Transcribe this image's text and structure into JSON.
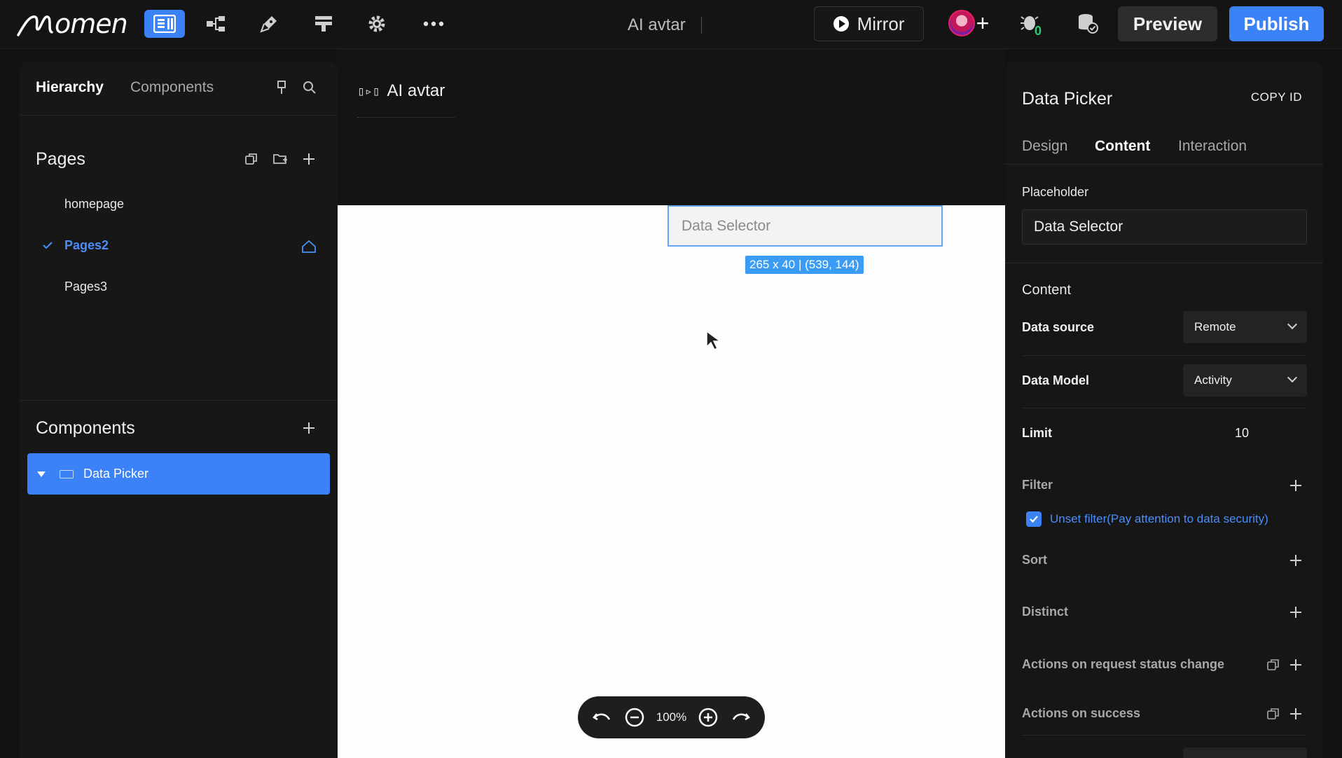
{
  "app": {
    "logo_text": "omen"
  },
  "toolbar": {
    "project_title": "AI avtar",
    "mirror_label": "Mirror",
    "preview_label": "Preview",
    "publish_label": "Publish",
    "badge_count": "0"
  },
  "left_panel": {
    "tabs": [
      {
        "label": "Hierarchy",
        "active": true
      },
      {
        "label": "Components",
        "active": false
      }
    ],
    "pages_title": "Pages",
    "pages": [
      {
        "label": "homepage",
        "active": false
      },
      {
        "label": "Pages2",
        "active": true,
        "home": true
      },
      {
        "label": "Pages3",
        "active": false
      }
    ],
    "components_title": "Components",
    "components": [
      {
        "label": "Data Picker",
        "selected": true
      }
    ]
  },
  "canvas": {
    "page_name": "AI avtar",
    "selected_component_text": "Data Selector",
    "size_badge": "265 x 40 | (539, 144)",
    "zoom_level": "100%"
  },
  "right_panel": {
    "title": "Data Picker",
    "copy_id_label": "COPY ID",
    "tabs": [
      {
        "label": "Design",
        "active": false
      },
      {
        "label": "Content",
        "active": true
      },
      {
        "label": "Interaction",
        "active": false
      }
    ],
    "placeholder_label": "Placeholder",
    "placeholder_value": "Data Selector",
    "content_section": "Content",
    "data_source_label": "Data source",
    "data_source_value": "Remote",
    "data_model_label": "Data Model",
    "data_model_value": "Activity",
    "limit_label": "Limit",
    "limit_value": "10",
    "filter_label": "Filter",
    "unset_filter_label": "Unset filter(Pay attention to data security)",
    "unset_filter_checked": true,
    "sort_label": "Sort",
    "distinct_label": "Distinct",
    "actions_status_label": "Actions on request status change",
    "actions_success_label": "Actions on success"
  },
  "colors": {
    "accent": "#3b82f6",
    "link": "#4b8ef8",
    "badge": "#3b9cf5",
    "background": "#121212",
    "panel": "#171717"
  }
}
